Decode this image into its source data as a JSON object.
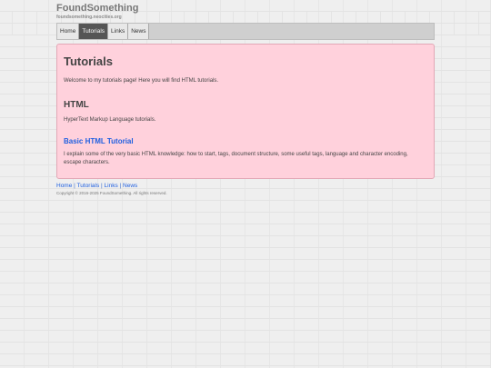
{
  "header": {
    "site_title": "FoundSomething",
    "site_subtitle": "foundsomething.neocities.org"
  },
  "nav": {
    "items": [
      {
        "label": "Home"
      },
      {
        "label": "Tutorials"
      },
      {
        "label": "Links"
      },
      {
        "label": "News"
      }
    ],
    "active": "Tutorials"
  },
  "main": {
    "title": "Tutorials",
    "intro": "Welcome to my tutorials page! Here you will find HTML tutorials.",
    "section_title": "HTML",
    "section_desc": "HyperText Markup Language tutorials.",
    "tutorial_title": "Basic HTML Tutorial",
    "tutorial_desc": "I explain some of the very basic HTML knowledge: how to start, tags, document structure, some useful tags, language and character encoding, escape characters."
  },
  "footer": {
    "links": [
      {
        "label": "Home"
      },
      {
        "label": "Tutorials"
      },
      {
        "label": "Links"
      },
      {
        "label": "News"
      }
    ],
    "separator": "|",
    "copyright": "Copyright © 2016-2025 FoundSomething. All rights reserved."
  },
  "colors": {
    "panel_bg": "#ffd1dc",
    "panel_border": "#e2a8b6",
    "link": "#1f5fe0",
    "nav_active_bg": "#555555",
    "page_bg": "#efefef"
  }
}
